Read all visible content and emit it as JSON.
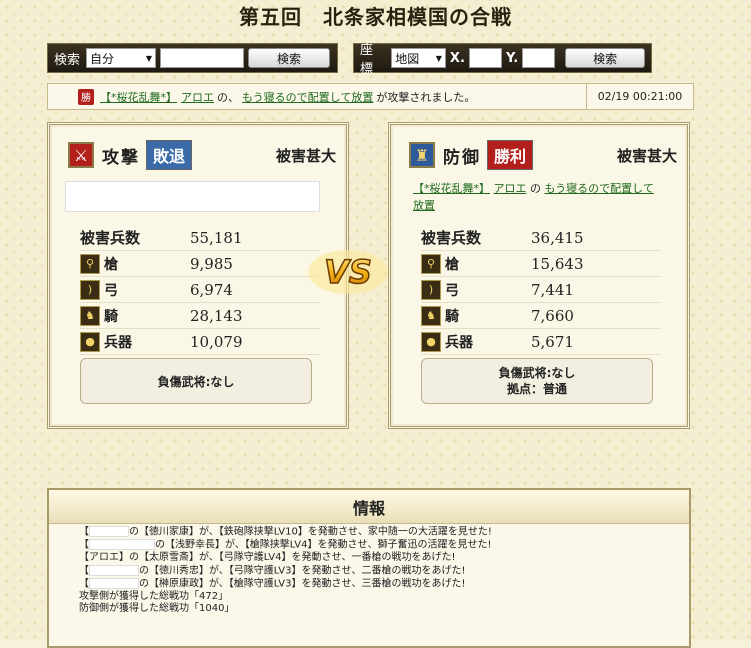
{
  "title": "第五回　北条家相模国の合戦",
  "search": {
    "label": "検索",
    "select": "自分",
    "button": "検索"
  },
  "coord": {
    "label": "座標",
    "select": "地図",
    "x_label": "X.",
    "y_label": "Y.",
    "button": "検索"
  },
  "notice": {
    "badge": "勝",
    "alliance": "【*桜花乱舞*】",
    "player": "アロエ",
    "text1": "の、",
    "target": "もう寝るので配置して放置",
    "text2": "が攻撃されました。",
    "datetime": "02/19 00:21:00"
  },
  "attack": {
    "role": "攻撃",
    "result": "敗退",
    "damage": "被害甚大",
    "total_label": "被害兵数",
    "total": "55,181",
    "units": [
      {
        "name": "槍",
        "value": "9,985",
        "icon": "spear-icon"
      },
      {
        "name": "弓",
        "value": "6,974",
        "icon": "bow-icon"
      },
      {
        "name": "騎",
        "value": "28,143",
        "icon": "horse-icon"
      },
      {
        "name": "兵器",
        "value": "10,079",
        "icon": "siege-icon"
      }
    ],
    "injured": "負傷武将:なし"
  },
  "defense": {
    "role": "防御",
    "result": "勝利",
    "damage": "被害甚大",
    "alliance": "【*桜花乱舞*】",
    "player": "アロエ",
    "sep": "の",
    "target": "もう寝るので配置して放置",
    "total_label": "被害兵数",
    "total": "36,415",
    "units": [
      {
        "name": "槍",
        "value": "15,643",
        "icon": "spear-icon"
      },
      {
        "name": "弓",
        "value": "7,441",
        "icon": "bow-icon"
      },
      {
        "name": "騎",
        "value": "7,660",
        "icon": "horse-icon"
      },
      {
        "name": "兵器",
        "value": "5,671",
        "icon": "siege-icon"
      }
    ],
    "injured": "負傷武将:なし",
    "base": "拠点：普通"
  },
  "vs": "VS",
  "info": {
    "title": "情報",
    "lines": [
      "の【徳川家康】が、【鉄砲隊挟撃LV10】を発動させ、家中随一の大活躍を見せた!",
      "の【浅野幸長】が、【槍隊挟撃LV4】を発動させ、獅子奮迅の活躍を見せた!",
      "【アロエ】の【太原雪斎】が、【弓隊守護LV4】を発動させ、一番槍の戦功をあげた!",
      "の【徳川秀忠】が、【弓隊守護LV3】を発動させ、二番槍の戦功をあげた!",
      "の【榊原康政】が、【槍隊守護LV3】を発動させ、三番槍の戦功をあげた!",
      "攻撃側が獲得した総戦功「472」",
      "防御側が獲得した総戦功「1040」"
    ]
  },
  "colors": {
    "lose": "#3a6aa8",
    "win": "#b3201c"
  }
}
